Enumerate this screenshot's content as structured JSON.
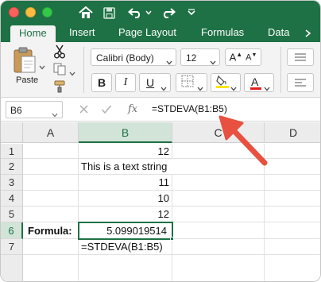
{
  "ribbon_tabs": [
    "Home",
    "Insert",
    "Page Layout",
    "Formulas",
    "Data"
  ],
  "ribbon": {
    "paste_label": "Paste",
    "font_name": "Calibri (Body)",
    "font_size": "12",
    "bold": "B",
    "italic": "I",
    "underline": "U",
    "font_color_letter": "A",
    "increase_font": "A",
    "decrease_font": "A"
  },
  "formula_bar": {
    "name_box": "B6",
    "fx": "fx",
    "formula": "=STDEVA(B1:B5)"
  },
  "columns": [
    "A",
    "B",
    "C",
    "D"
  ],
  "rows": [
    "1",
    "2",
    "3",
    "4",
    "5",
    "6",
    "7"
  ],
  "cells": {
    "B1": "12",
    "B2": "This is a text string",
    "B3": "11",
    "B4": "10",
    "B5": "12",
    "A6": "Formula:",
    "B6": "5.099019514",
    "B7": "=STDEVA(B1:B5)"
  },
  "colors": {
    "accent": "#1e7145",
    "arrow": "#e8503f",
    "highlight_fill": "#ffe400",
    "font_color": "#e02020"
  }
}
